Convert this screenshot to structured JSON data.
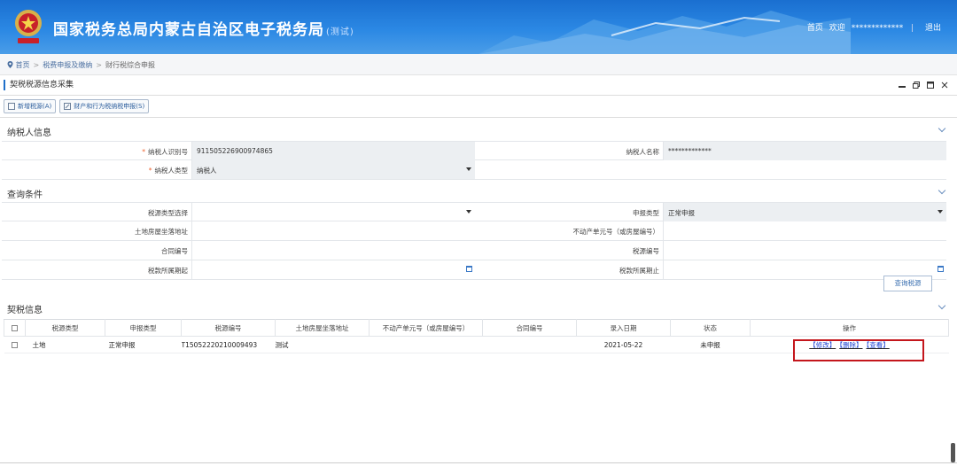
{
  "header": {
    "title": "国家税务总局内蒙古自治区电子税务局",
    "test_tag": "(测试)",
    "home": "首页",
    "welcome": "欢迎",
    "user": "*************",
    "separator": "|",
    "logout": "退出"
  },
  "breadcrumb": {
    "home_icon": "location-pin-icon",
    "items": [
      "首页",
      "税费申报及缴纳",
      "财行税综合申报"
    ],
    "arrow": ">"
  },
  "panel": {
    "title": "契税税源信息采集",
    "controls": [
      "minimize-icon",
      "restore-icon",
      "maximize-icon",
      "close-icon"
    ]
  },
  "toolbar": {
    "add_label": "新增税源(A)",
    "declare_label": "财产和行为税纳税申报(S)"
  },
  "taxpayer": {
    "section_title": "纳税人信息",
    "id_label": "纳税人识别号",
    "id_value": "911505226900974865",
    "name_label": "纳税人名称",
    "name_value": "*************",
    "type_label": "纳税人类型",
    "type_value": "纳税人"
  },
  "query": {
    "section_title": "查询条件",
    "source_type_label": "税源类型选择",
    "source_type_value": "",
    "declare_type_label": "申报类型",
    "declare_type_value": "正常申报",
    "address_label": "土地房屋坐落地址",
    "address_value": "",
    "realty_no_label": "不动产单元号（或房屋编号）",
    "realty_no_value": "",
    "contract_label": "合同编号",
    "contract_value": "",
    "source_no_label": "税源编号",
    "source_no_value": "",
    "period_start_label": "税款所属期起",
    "period_start_value": "",
    "period_end_label": "税款所属期止",
    "period_end_value": "",
    "query_button": "查询税源"
  },
  "deed": {
    "section_title": "契税信息",
    "columns": [
      "税源类型",
      "申报类型",
      "税源编号",
      "土地房屋坐落地址",
      "不动产单元号（或房屋编号）",
      "合同编号",
      "录入日期",
      "状态",
      "操作"
    ],
    "rows": [
      {
        "source_type": "土地",
        "declare_type": "正常申报",
        "source_no": "T15052220210009493",
        "address": "测试",
        "realty_no": "",
        "contract": "",
        "date": "2021-05-22",
        "status": "未申报",
        "op_edit": "【修改】",
        "op_delete": "【删除】",
        "op_view": "【查看】"
      }
    ]
  },
  "colors": {
    "header_blue": "#2b88e4",
    "link_blue": "#1a3fd0",
    "highlight_red": "#c4161c",
    "required_star": "#e63"
  }
}
